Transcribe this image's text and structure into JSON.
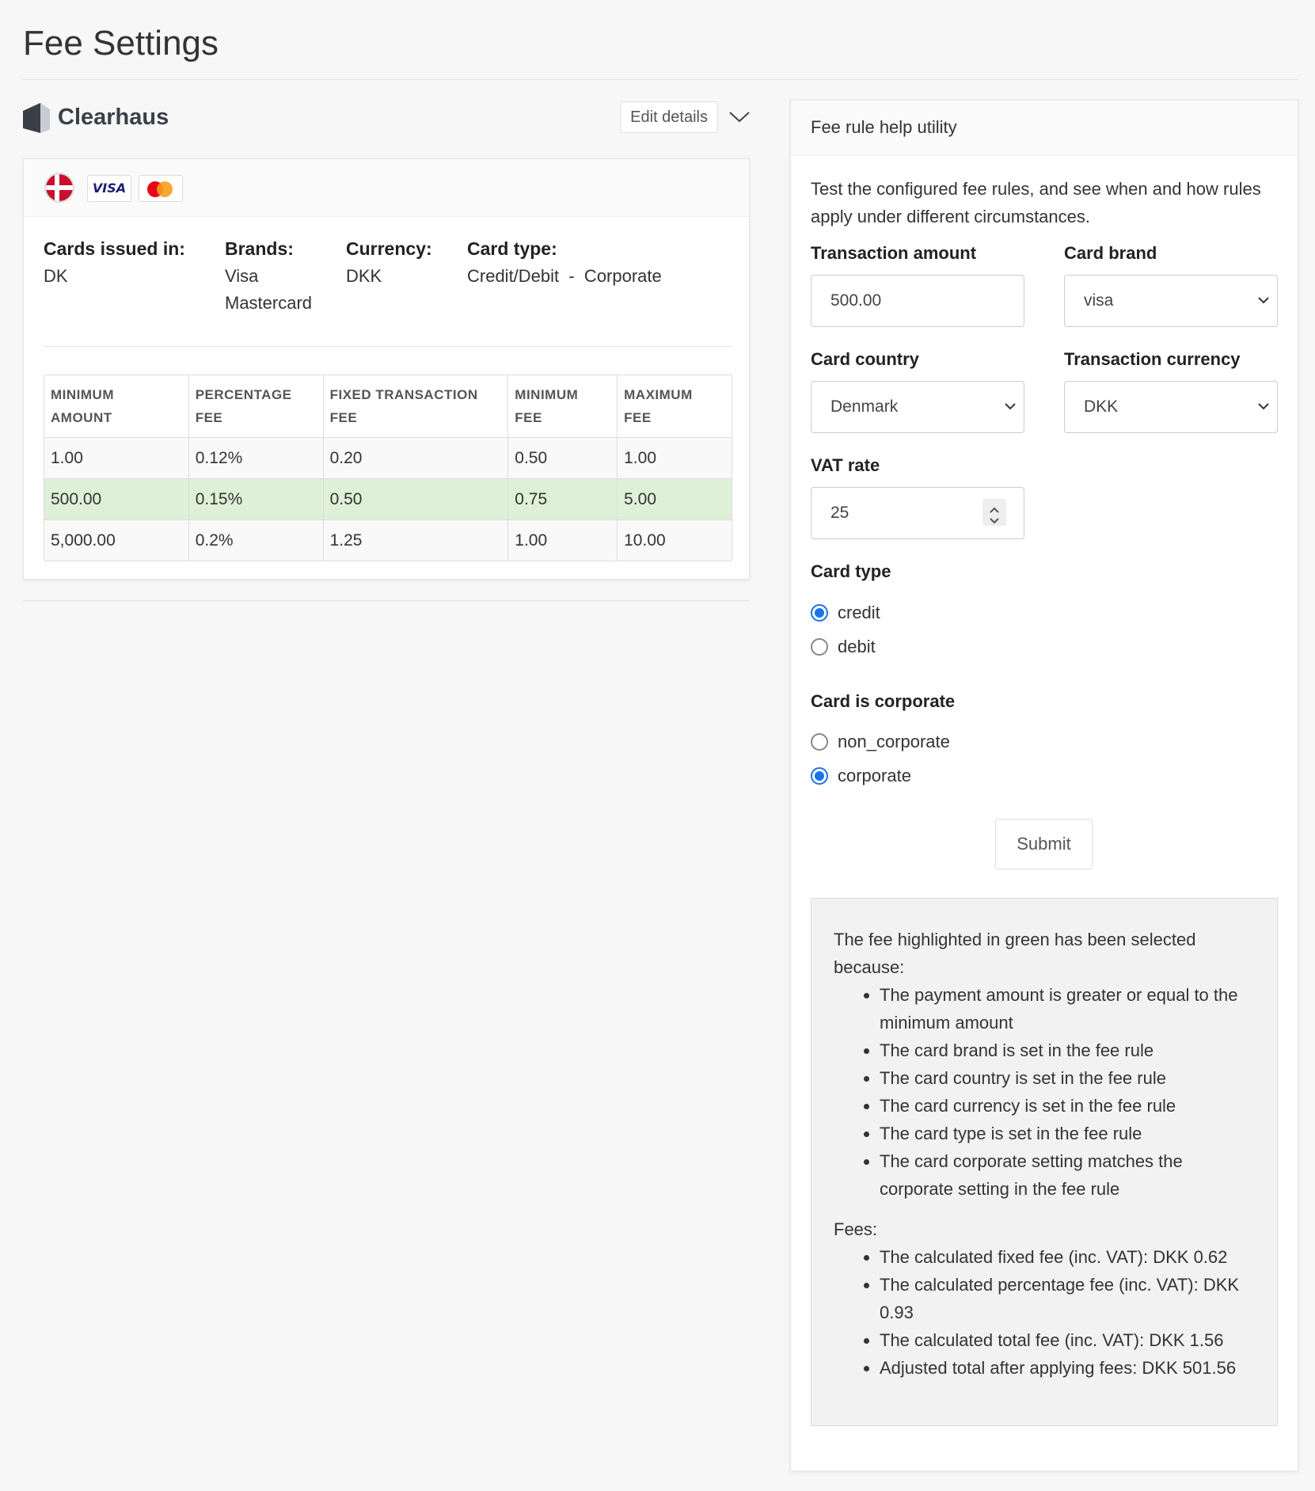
{
  "page": {
    "title": "Fee Settings"
  },
  "provider": {
    "name": "Clearhaus",
    "edit_label": "Edit details",
    "logo_icon": "clearhaus-logo-icon",
    "colors": {
      "logo": "#3a3f47"
    }
  },
  "rule": {
    "chips": [
      "flag-denmark-icon",
      "visa-icon",
      "mastercard-icon"
    ],
    "visa_text": "VISA",
    "cards_issued": {
      "label": "Cards issued in:",
      "values": [
        "DK"
      ]
    },
    "brands": {
      "label": "Brands:",
      "values": [
        "Visa",
        "Mastercard"
      ]
    },
    "currency": {
      "label": "Currency:",
      "values": [
        "DKK"
      ]
    },
    "card_type": {
      "label": "Card type:",
      "values": [
        "Credit/Debit  -  Corporate"
      ]
    }
  },
  "fee_table": {
    "headers": [
      [
        "MINIMUM",
        "AMOUNT"
      ],
      [
        "PERCENTAGE",
        "FEE"
      ],
      [
        "FIXED TRANSACTION",
        "FEE"
      ],
      [
        "MINIMUM",
        "FEE"
      ],
      [
        "MAXIMUM",
        "FEE"
      ]
    ],
    "rows": [
      [
        "1.00",
        "0.12%",
        "0.20",
        "0.50",
        "1.00"
      ],
      [
        "500.00",
        "0.15%",
        "0.50",
        "0.75",
        "5.00"
      ],
      [
        "5,000.00",
        "0.2%",
        "1.25",
        "1.00",
        "10.00"
      ]
    ],
    "highlight_row": 1,
    "highlight_color": "#dff0d8"
  },
  "help": {
    "title": "Fee rule help utility",
    "description": "Test the configured fee rules, and see when and how rules apply under different circumstances.",
    "transaction_amount": {
      "label": "Transaction amount",
      "value": "500.00"
    },
    "card_brand": {
      "label": "Card brand",
      "value": "visa"
    },
    "card_country": {
      "label": "Card country",
      "value": "Denmark"
    },
    "transaction_currency": {
      "label": "Transaction currency",
      "value": "DKK"
    },
    "vat_rate": {
      "label": "VAT rate",
      "value": "25"
    },
    "card_type": {
      "label": "Card type",
      "options": [
        "credit",
        "debit"
      ],
      "selected": "credit"
    },
    "card_corporate": {
      "label": "Card is corporate",
      "options": [
        "non_corporate",
        "corporate"
      ],
      "selected": "corporate"
    },
    "submit_label": "Submit",
    "accent_color": "#1a73e8",
    "result": {
      "intro": "The fee highlighted in green has been selected because:",
      "reasons": [
        "The payment amount is greater or equal to the minimum amount",
        "The card brand is set in the fee rule",
        "The card country is set in the fee rule",
        "The card currency is set in the fee rule",
        "The card type is set in the fee rule",
        "The card corporate setting matches the corporate setting in the fee rule"
      ],
      "fees_label": "Fees:",
      "fees": [
        "The calculated fixed fee (inc. VAT): DKK 0.62",
        "The calculated percentage fee (inc. VAT): DKK 0.93",
        "The calculated total fee (inc. VAT): DKK 1.56",
        "Adjusted total after applying fees: DKK 501.56"
      ]
    }
  }
}
